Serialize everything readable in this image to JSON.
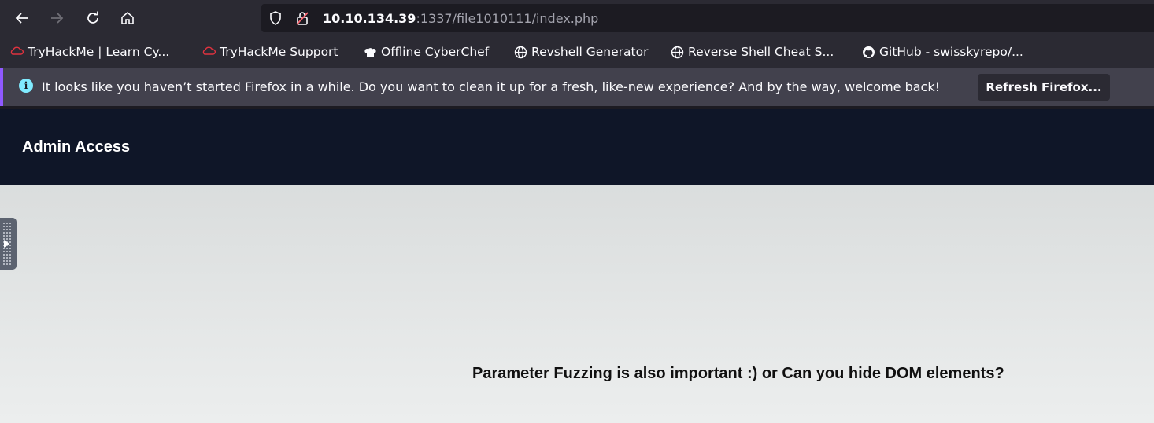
{
  "browser": {
    "url": {
      "host": "10.10.134.39",
      "rest": ":1337/file1010111/index.php"
    },
    "bookmarks": [
      {
        "label": "TryHackMe | Learn Cy...",
        "icon": "tryhackme-icon"
      },
      {
        "label": "TryHackMe Support",
        "icon": "tryhackme-icon"
      },
      {
        "label": "Offline CyberChef",
        "icon": "chef-hat-icon"
      },
      {
        "label": "Revshell Generator",
        "icon": "globe-icon"
      },
      {
        "label": "Reverse Shell Cheat S...",
        "icon": "globe-icon"
      },
      {
        "label": "GitHub - swisskyrepo/...",
        "icon": "github-icon"
      }
    ],
    "notification": {
      "text": "It looks like you haven’t started Firefox in a while. Do you want to clean it up for a fresh, like-new experience? And by the way, welcome back!",
      "button": "Refresh Firefox..."
    }
  },
  "page": {
    "title": "Admin Access",
    "message": "Parameter Fuzzing is also important :) or Can you hide DOM elements?"
  },
  "colors": {
    "toolbar": "#2b2a33",
    "header": "#0f1628",
    "accent": "#9059ff"
  }
}
